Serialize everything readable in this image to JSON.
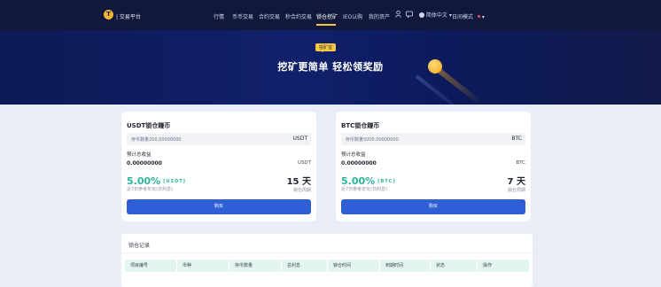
{
  "nav": {
    "logo_letter": "T",
    "brand": "| 交易平台",
    "items": [
      "行情",
      "币币交易",
      "合约交易",
      "秒合约交易",
      "锁仓挖矿",
      "IEO认购",
      "我的资产"
    ],
    "lang": "简体中文",
    "theme": "日间模式"
  },
  "hero": {
    "badge": "挖矿宝",
    "title": "挖矿更简单 轻松领奖励"
  },
  "cards": [
    {
      "title": "USDT锁仓赚币",
      "placeholder": "存币数量200.00000000",
      "unit": "USDT",
      "income_label": "预计总收益",
      "income_value": "0.00000000",
      "income_unit": "USDT",
      "rate": "5.00%",
      "rate_tag": "[USDT]",
      "rate_sub": "近7日参考年化(日利息)",
      "days": "15 天",
      "days_sub": "锁仓周期",
      "buy": "购买"
    },
    {
      "title": "BTC锁仓赚币",
      "placeholder": "存币数量5000.00000000",
      "unit": "BTC",
      "income_label": "预计总收益",
      "income_value": "0.00000000",
      "income_unit": "BTC",
      "rate": "5.00%",
      "rate_tag": "[BTC]",
      "rate_sub": "近7日参考年化(日利息)",
      "days": "7 天",
      "days_sub": "锁仓周期",
      "buy": "购买"
    }
  ],
  "records": {
    "title": "锁仓记录",
    "columns": [
      "项目编号",
      "币种",
      "存币数量",
      "总利息",
      "锁仓时间",
      "到期时间",
      "状态",
      "操作"
    ]
  },
  "colors": {
    "nav_bg": "#11183b",
    "hero_bg": "#10206b",
    "accent_green": "#2bb39b",
    "button_blue": "#2f5fd6",
    "badge_yellow": "#f6c944"
  }
}
